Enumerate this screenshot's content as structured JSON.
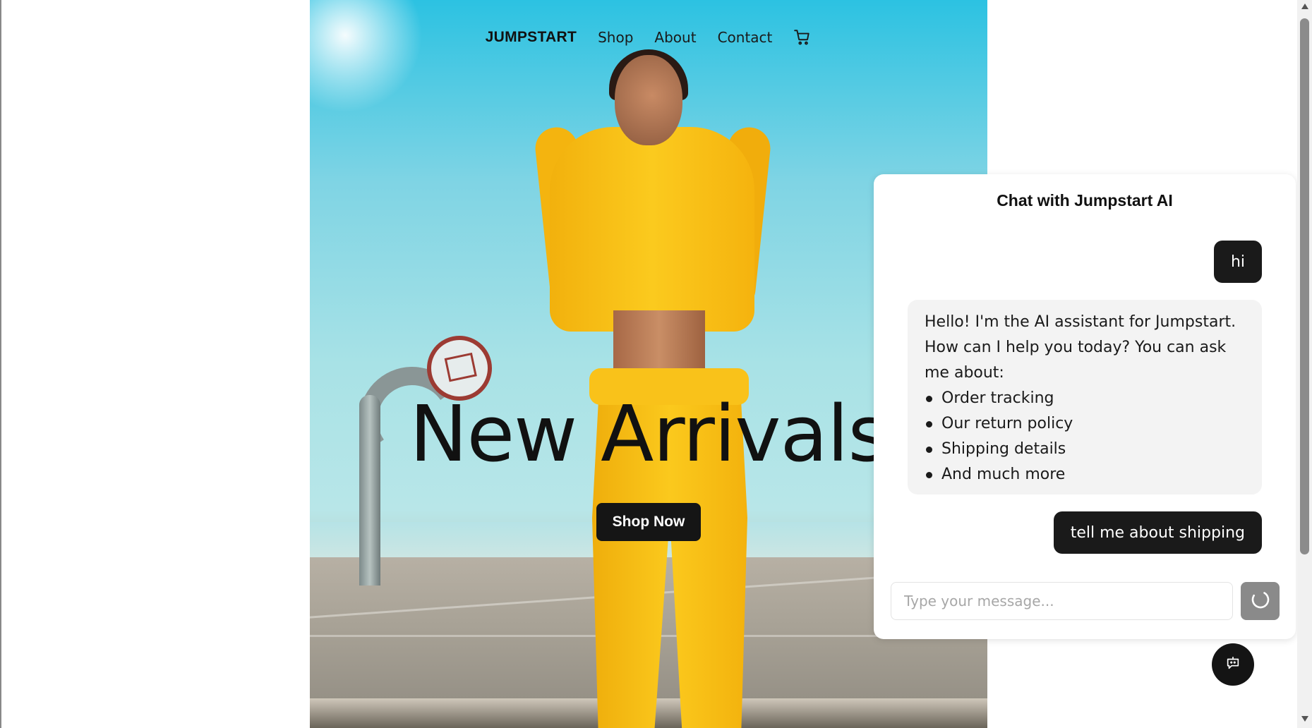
{
  "nav": {
    "brand": "JUMPSTART",
    "links": [
      "Shop",
      "About",
      "Contact"
    ],
    "cart_icon": "cart-icon"
  },
  "hero": {
    "headline": "New Arrivals",
    "cta_label": "Shop Now",
    "image_description_icon": "hero-photo"
  },
  "chat": {
    "title": "Chat with Jumpstart AI",
    "messages": [
      {
        "role": "user",
        "text": "hi"
      },
      {
        "role": "assistant",
        "intro": "Hello! I'm the AI assistant for Jumpstart. How can I help you today? You can ask me about:",
        "items": [
          "Order tracking",
          "Our return policy",
          "Shipping details",
          "And much more"
        ]
      },
      {
        "role": "user",
        "text": "tell me about shipping"
      }
    ],
    "input_placeholder": "Type your message...",
    "input_value": "",
    "send_state_icon": "loading-spinner-icon"
  },
  "fab": {
    "icon": "chat-bot-icon"
  },
  "colors": {
    "user_bubble": "#1a1a1a",
    "bot_bubble": "#f3f3f3",
    "cta_bg": "#151515",
    "send_disabled": "#8a8a8a"
  }
}
